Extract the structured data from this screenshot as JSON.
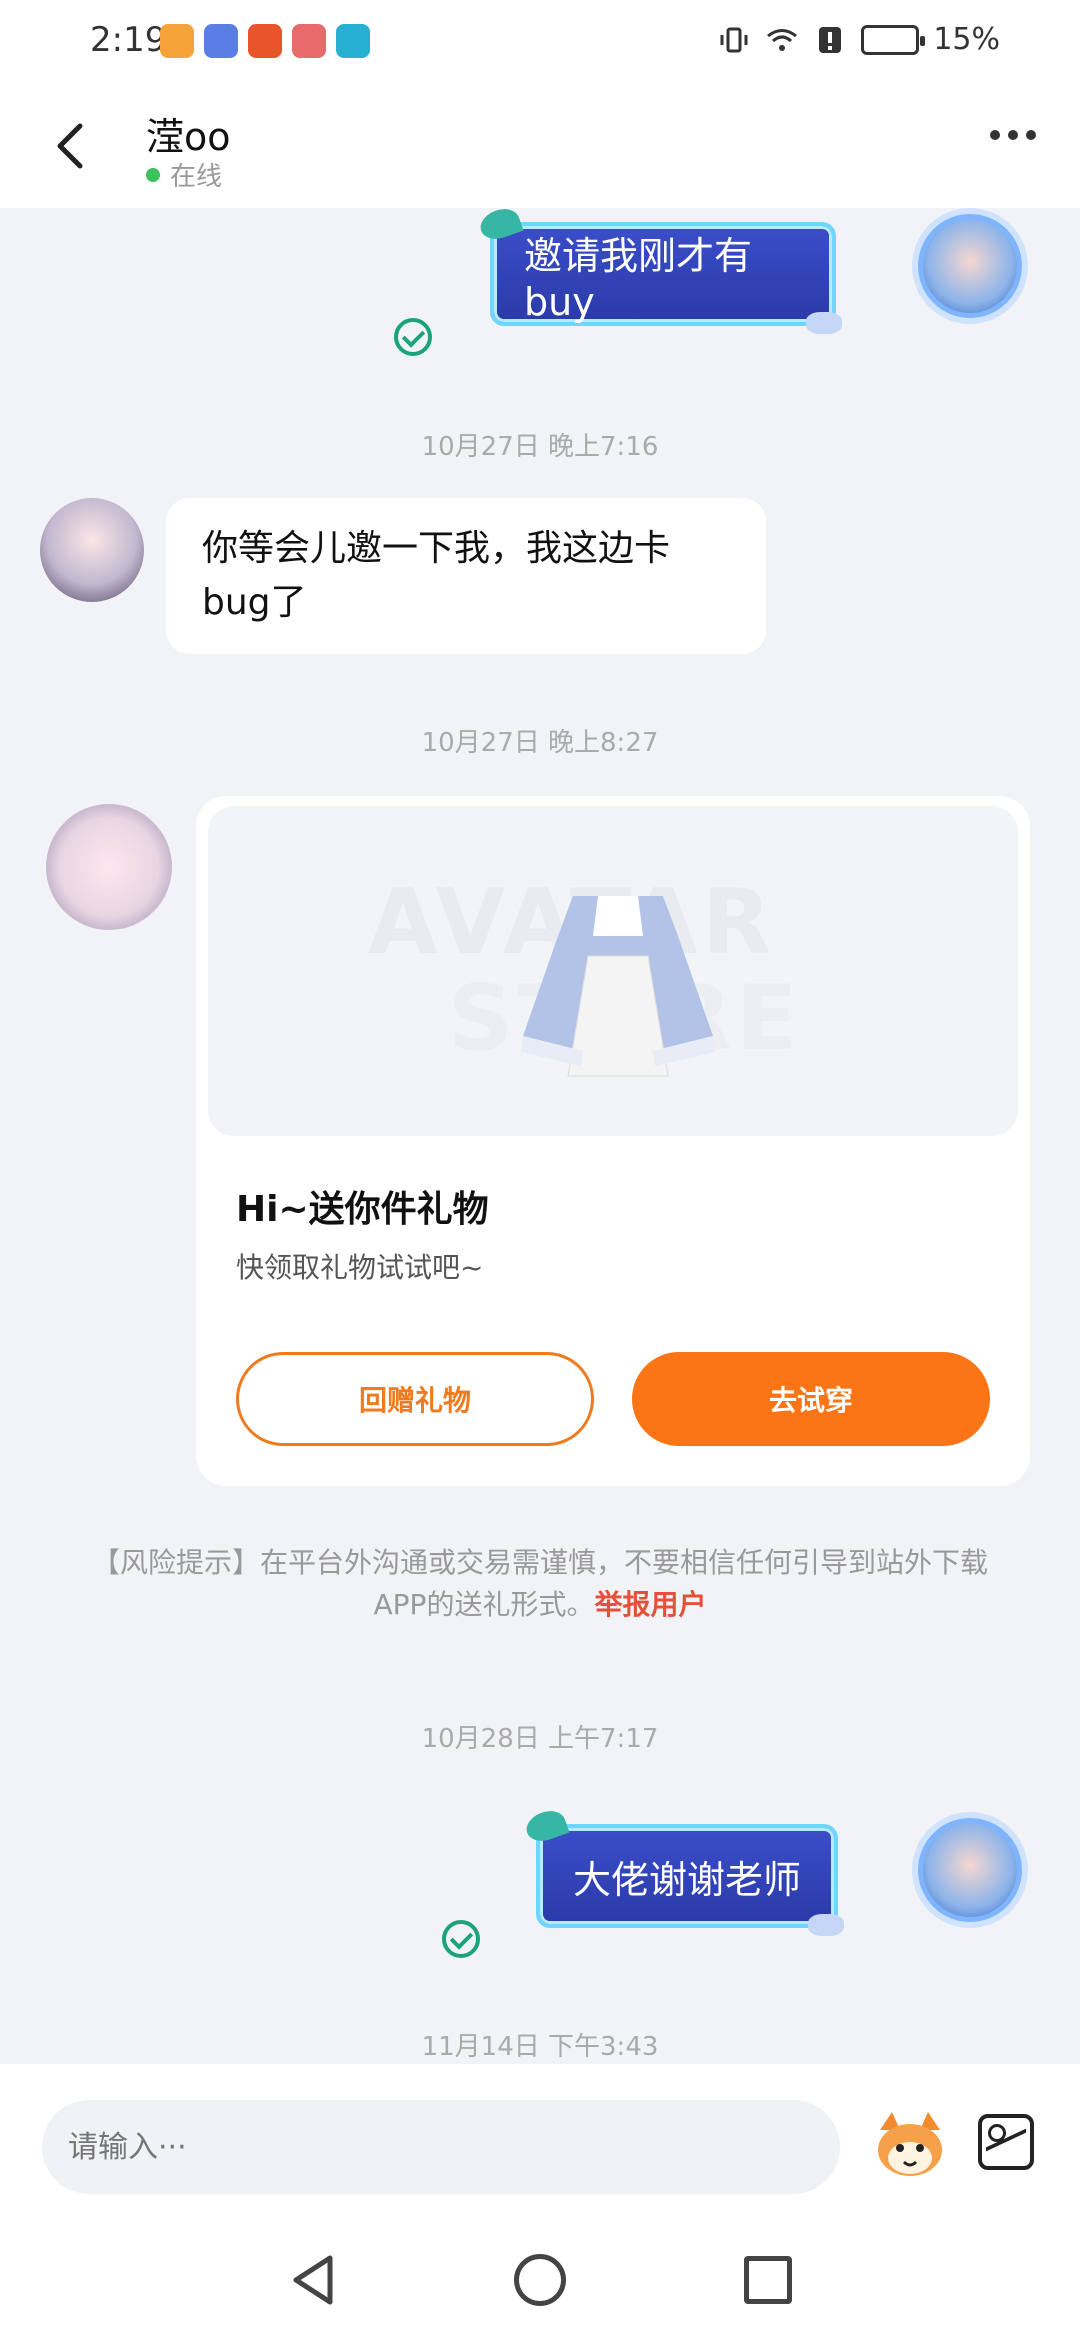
{
  "status_bar": {
    "time": "2:19",
    "battery": "15%",
    "app_icon_colors": [
      "#f7a23b",
      "#5b7de6",
      "#e9552b",
      "#e86b6b",
      "#27b0d1"
    ]
  },
  "header": {
    "contact_name": "滢oo",
    "presence": "在线",
    "presence_color": "#3bc25a"
  },
  "messages": {
    "m1": {
      "text": "邀请我刚才有buy"
    },
    "t1": "10月27日 晚上7:16",
    "m2": {
      "text": "你等会儿邀一下我，我这边卡bug了"
    },
    "t2": "10月27日 晚上8:27",
    "gift": {
      "watermark_line1": "AVATAR",
      "watermark_line2": "STORE",
      "title": "Hi~送你件礼物",
      "subtitle": "快领取礼物试试吧~",
      "return_gift_label": "回赠礼物",
      "try_on_label": "去试穿"
    },
    "risk": {
      "text": "【风险提示】在平台外沟通或交易需谨慎，不要相信任何引导到站外下载APP的送礼形式。",
      "report_link": "举报用户"
    },
    "t3": "10月28日 上午7:17",
    "m3": {
      "text": "大佬谢谢老师"
    },
    "t4": "11月14日 下午3:43"
  },
  "input_bar": {
    "placeholder": "请输入···"
  },
  "colors": {
    "accent_orange": "#fb7415",
    "read_check": "#1ba37b",
    "report_red": "#e4513a"
  }
}
